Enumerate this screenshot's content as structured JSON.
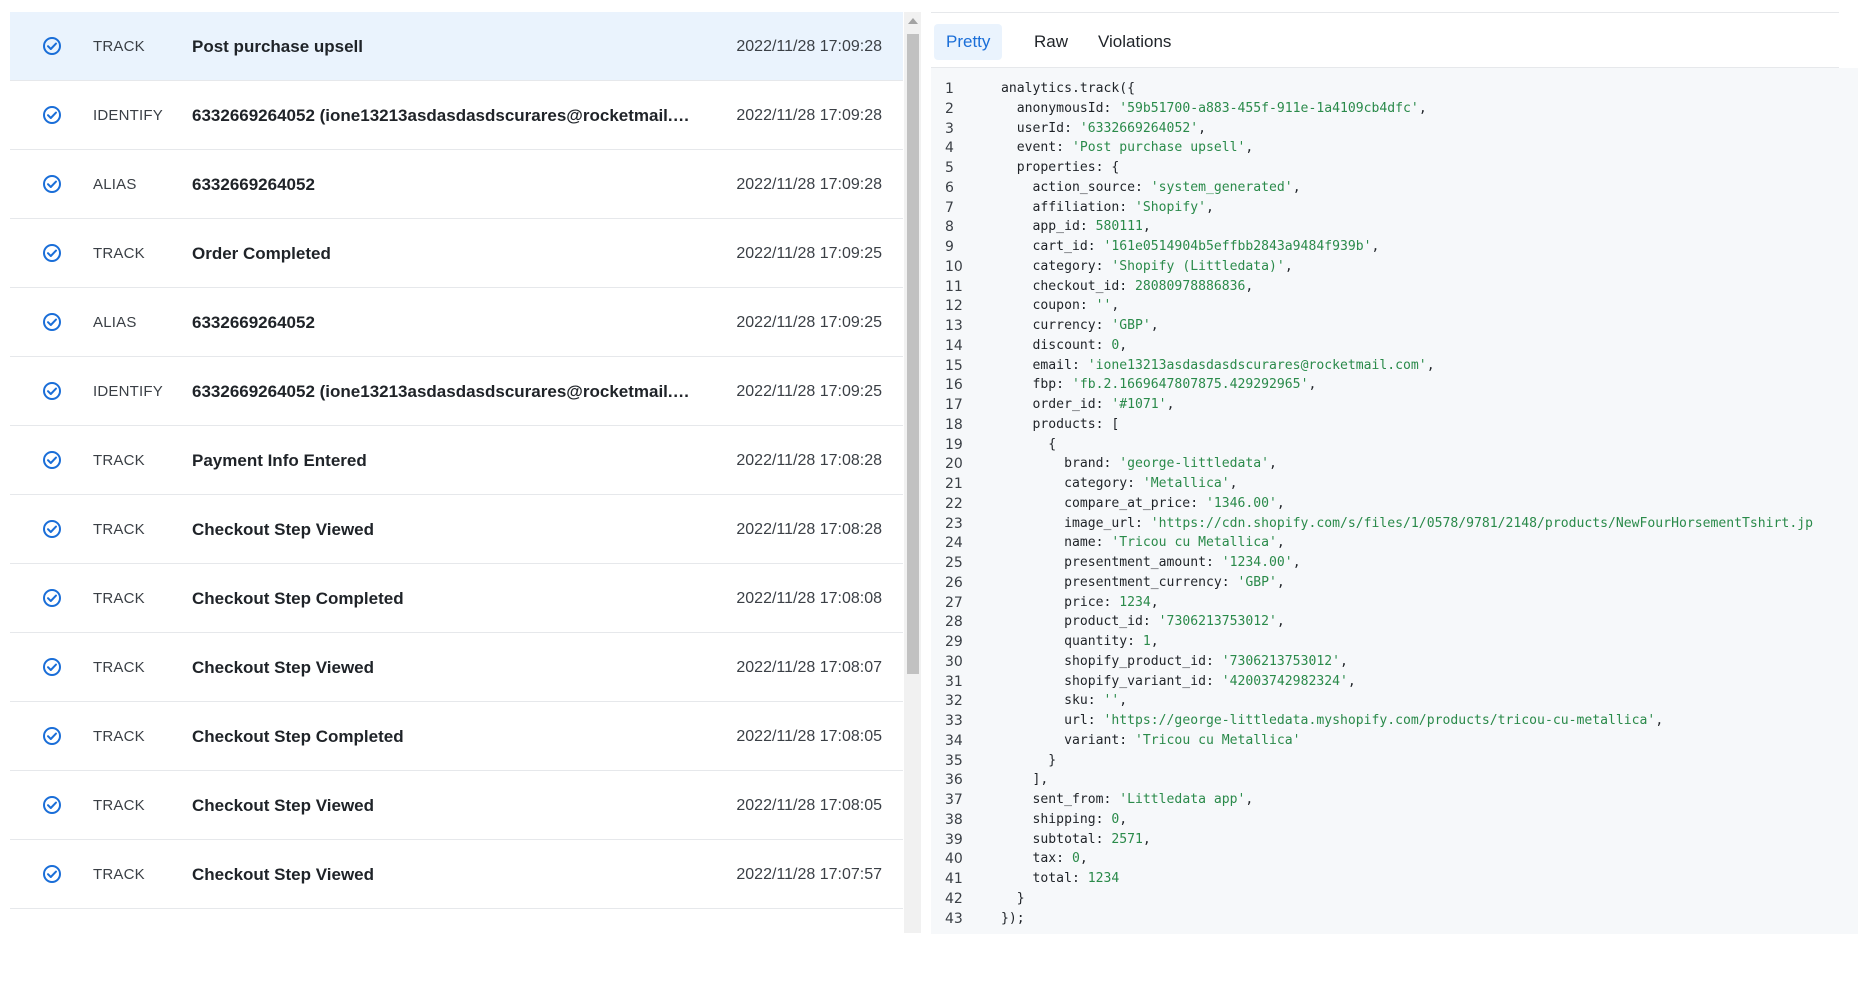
{
  "events": [
    {
      "type": "TRACK",
      "name": "Post purchase upsell",
      "time": "2022/11/28 17:09:28",
      "selected": true
    },
    {
      "type": "IDENTIFY",
      "name": "6332669264052 (ione13213asdasdasdscurares@rocketmail.c...",
      "time": "2022/11/28 17:09:28"
    },
    {
      "type": "ALIAS",
      "name": "6332669264052",
      "time": "2022/11/28 17:09:28"
    },
    {
      "type": "TRACK",
      "name": "Order Completed",
      "time": "2022/11/28 17:09:25"
    },
    {
      "type": "ALIAS",
      "name": "6332669264052",
      "time": "2022/11/28 17:09:25"
    },
    {
      "type": "IDENTIFY",
      "name": "6332669264052 (ione13213asdasdasdscurares@rocketmail.c...",
      "time": "2022/11/28 17:09:25"
    },
    {
      "type": "TRACK",
      "name": "Payment Info Entered",
      "time": "2022/11/28 17:08:28"
    },
    {
      "type": "TRACK",
      "name": "Checkout Step Viewed",
      "time": "2022/11/28 17:08:28"
    },
    {
      "type": "TRACK",
      "name": "Checkout Step Completed",
      "time": "2022/11/28 17:08:08"
    },
    {
      "type": "TRACK",
      "name": "Checkout Step Viewed",
      "time": "2022/11/28 17:08:07"
    },
    {
      "type": "TRACK",
      "name": "Checkout Step Completed",
      "time": "2022/11/28 17:08:05"
    },
    {
      "type": "TRACK",
      "name": "Checkout Step Viewed",
      "time": "2022/11/28 17:08:05"
    },
    {
      "type": "TRACK",
      "name": "Checkout Step Viewed",
      "time": "2022/11/28 17:07:57"
    }
  ],
  "status_icon": "check-circle-icon",
  "tabs": [
    {
      "label": "Pretty",
      "active": true
    },
    {
      "label": "Raw"
    },
    {
      "label": "Violations"
    }
  ],
  "colors": {
    "accent": "#1a6ed8",
    "selected_row": "#eaf3fd",
    "string": "#2a8a4a"
  },
  "code_lines": [
    [
      [
        "p",
        "analytics.track({"
      ]
    ],
    [
      [
        "p",
        "  anonymousId: "
      ],
      [
        "s",
        "'59b51700-a883-455f-911e-1a4109cb4dfc'"
      ],
      [
        "p",
        ","
      ]
    ],
    [
      [
        "p",
        "  userId: "
      ],
      [
        "s",
        "'6332669264052'"
      ],
      [
        "p",
        ","
      ]
    ],
    [
      [
        "p",
        "  event: "
      ],
      [
        "s",
        "'Post purchase upsell'"
      ],
      [
        "p",
        ","
      ]
    ],
    [
      [
        "p",
        "  properties: {"
      ]
    ],
    [
      [
        "p",
        "    action_source: "
      ],
      [
        "s",
        "'system_generated'"
      ],
      [
        "p",
        ","
      ]
    ],
    [
      [
        "p",
        "    affiliation: "
      ],
      [
        "s",
        "'Shopify'"
      ],
      [
        "p",
        ","
      ]
    ],
    [
      [
        "p",
        "    app_id: "
      ],
      [
        "n",
        "580111"
      ],
      [
        "p",
        ","
      ]
    ],
    [
      [
        "p",
        "    cart_id: "
      ],
      [
        "s",
        "'161e0514904b5effbb2843a9484f939b'"
      ],
      [
        "p",
        ","
      ]
    ],
    [
      [
        "p",
        "    category: "
      ],
      [
        "s",
        "'Shopify (Littledata)'"
      ],
      [
        "p",
        ","
      ]
    ],
    [
      [
        "p",
        "    checkout_id: "
      ],
      [
        "n",
        "28080978886836"
      ],
      [
        "p",
        ","
      ]
    ],
    [
      [
        "p",
        "    coupon: "
      ],
      [
        "s",
        "''"
      ],
      [
        "p",
        ","
      ]
    ],
    [
      [
        "p",
        "    currency: "
      ],
      [
        "s",
        "'GBP'"
      ],
      [
        "p",
        ","
      ]
    ],
    [
      [
        "p",
        "    discount: "
      ],
      [
        "n",
        "0"
      ],
      [
        "p",
        ","
      ]
    ],
    [
      [
        "p",
        "    email: "
      ],
      [
        "s",
        "'ione13213asdasdasdscurares@rocketmail.com'"
      ],
      [
        "p",
        ","
      ]
    ],
    [
      [
        "p",
        "    fbp: "
      ],
      [
        "s",
        "'fb.2.1669647807875.429292965'"
      ],
      [
        "p",
        ","
      ]
    ],
    [
      [
        "p",
        "    order_id: "
      ],
      [
        "s",
        "'#1071'"
      ],
      [
        "p",
        ","
      ]
    ],
    [
      [
        "p",
        "    products: ["
      ]
    ],
    [
      [
        "p",
        "      {"
      ]
    ],
    [
      [
        "p",
        "        brand: "
      ],
      [
        "s",
        "'george-littledata'"
      ],
      [
        "p",
        ","
      ]
    ],
    [
      [
        "p",
        "        category: "
      ],
      [
        "s",
        "'Metallica'"
      ],
      [
        "p",
        ","
      ]
    ],
    [
      [
        "p",
        "        compare_at_price: "
      ],
      [
        "s",
        "'1346.00'"
      ],
      [
        "p",
        ","
      ]
    ],
    [
      [
        "p",
        "        image_url: "
      ],
      [
        "s",
        "'https://cdn.shopify.com/s/files/1/0578/9781/2148/products/NewFourHorsementTshirt.jp"
      ]
    ],
    [
      [
        "p",
        "        name: "
      ],
      [
        "s",
        "'Tricou cu Metallica'"
      ],
      [
        "p",
        ","
      ]
    ],
    [
      [
        "p",
        "        presentment_amount: "
      ],
      [
        "s",
        "'1234.00'"
      ],
      [
        "p",
        ","
      ]
    ],
    [
      [
        "p",
        "        presentment_currency: "
      ],
      [
        "s",
        "'GBP'"
      ],
      [
        "p",
        ","
      ]
    ],
    [
      [
        "p",
        "        price: "
      ],
      [
        "n",
        "1234"
      ],
      [
        "p",
        ","
      ]
    ],
    [
      [
        "p",
        "        product_id: "
      ],
      [
        "s",
        "'7306213753012'"
      ],
      [
        "p",
        ","
      ]
    ],
    [
      [
        "p",
        "        quantity: "
      ],
      [
        "n",
        "1"
      ],
      [
        "p",
        ","
      ]
    ],
    [
      [
        "p",
        "        shopify_product_id: "
      ],
      [
        "s",
        "'7306213753012'"
      ],
      [
        "p",
        ","
      ]
    ],
    [
      [
        "p",
        "        shopify_variant_id: "
      ],
      [
        "s",
        "'42003742982324'"
      ],
      [
        "p",
        ","
      ]
    ],
    [
      [
        "p",
        "        sku: "
      ],
      [
        "s",
        "''"
      ],
      [
        "p",
        ","
      ]
    ],
    [
      [
        "p",
        "        url: "
      ],
      [
        "s",
        "'https://george-littledata.myshopify.com/products/tricou-cu-metallica'"
      ],
      [
        "p",
        ","
      ]
    ],
    [
      [
        "p",
        "        variant: "
      ],
      [
        "s",
        "'Tricou cu Metallica'"
      ]
    ],
    [
      [
        "p",
        "      }"
      ]
    ],
    [
      [
        "p",
        "    ],"
      ]
    ],
    [
      [
        "p",
        "    sent_from: "
      ],
      [
        "s",
        "'Littledata app'"
      ],
      [
        "p",
        ","
      ]
    ],
    [
      [
        "p",
        "    shipping: "
      ],
      [
        "n",
        "0"
      ],
      [
        "p",
        ","
      ]
    ],
    [
      [
        "p",
        "    subtotal: "
      ],
      [
        "n",
        "2571"
      ],
      [
        "p",
        ","
      ]
    ],
    [
      [
        "p",
        "    tax: "
      ],
      [
        "n",
        "0"
      ],
      [
        "p",
        ","
      ]
    ],
    [
      [
        "p",
        "    total: "
      ],
      [
        "n",
        "1234"
      ]
    ],
    [
      [
        "p",
        "  }"
      ]
    ],
    [
      [
        "p",
        "});"
      ]
    ]
  ]
}
